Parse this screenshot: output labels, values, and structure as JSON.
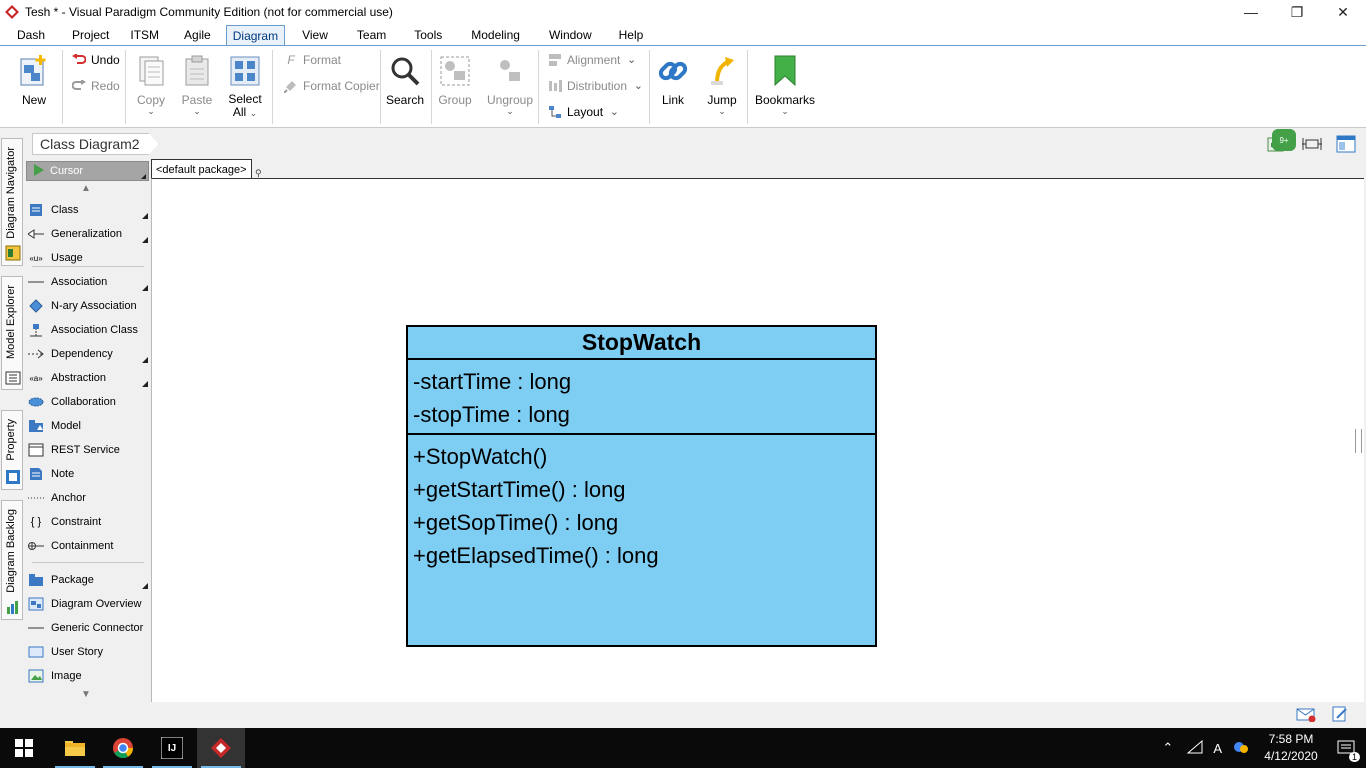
{
  "window": {
    "title": "Tesh * - Visual Paradigm Community Edition (not for commercial use)",
    "controls": [
      "minimize",
      "restore",
      "close"
    ]
  },
  "menu": [
    "Dash",
    "Project",
    "ITSM",
    "Agile",
    "Diagram",
    "View",
    "Team",
    "Tools",
    "Modeling",
    "Window",
    "Help"
  ],
  "active_menu": "Diagram",
  "ribbon": {
    "new": "New",
    "undo": "Undo",
    "redo": "Redo",
    "copy": "Copy",
    "paste": "Paste",
    "select_all_1": "Select",
    "select_all_2": "All",
    "format": "Format",
    "format_copier": "Format Copier",
    "search": "Search",
    "group": "Group",
    "ungroup": "Ungroup",
    "alignment": "Alignment",
    "distribution": "Distribution",
    "layout": "Layout",
    "link": "Link",
    "jump": "Jump",
    "bookmarks": "Bookmarks",
    "badge": "9+"
  },
  "side_tabs": [
    "Diagram Navigator",
    "Model Explorer",
    "Property",
    "Diagram Backlog"
  ],
  "breadcrumb": "Class Diagram2",
  "package_label": "<default package>",
  "palette": {
    "cursor": "Cursor",
    "items": [
      "Class",
      "Generalization",
      "Usage",
      "Association",
      "N-ary Association",
      "Association Class",
      "Dependency",
      "Abstraction",
      "Collaboration",
      "Model",
      "REST Service",
      "Note",
      "Anchor",
      "Constraint",
      "Containment",
      "Package",
      "Diagram Overview",
      "Generic Connector",
      "User Story",
      "Image"
    ]
  },
  "uml_class": {
    "name": "StopWatch",
    "attributes": [
      "-startTime : long",
      "-stopTime : long"
    ],
    "operations": [
      "+StopWatch()",
      "+getStartTime() : long",
      "+getSopTime() : long",
      "+getElapsedTime() : long"
    ]
  },
  "taskbar": {
    "time": "7:58 PM",
    "date": "4/12/2020",
    "notification_count": "1",
    "ime": "A",
    "intellij_label": "IJ"
  },
  "colors": {
    "uml_fill": "#7ecdf3",
    "accent": "#6b9ecf",
    "taskbar": "#0a0a0a"
  }
}
